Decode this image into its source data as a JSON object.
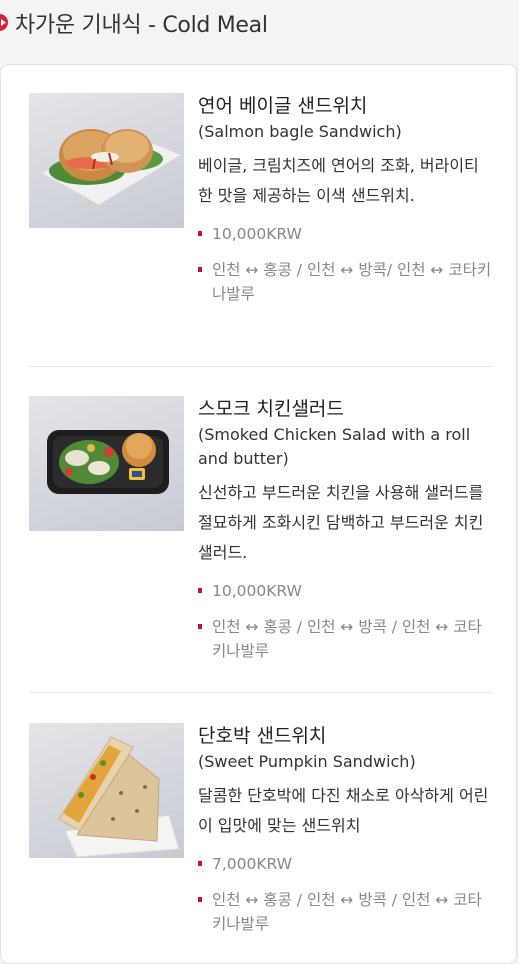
{
  "header": {
    "title": "차가운 기내식 - Cold Meal",
    "icon": "arrow-right-circle-icon",
    "accent_color": "#d8213a"
  },
  "items": [
    {
      "name": "연어 베이글 샌드위치",
      "english": "(Salmon bagle Sandwich)",
      "description": "베이글, 크림치즈에 연어의 조화, 버라이티한 맛을 제공하는 이색 샌드위치.",
      "price": "10,000KRW",
      "routes": "인천 ↔ 홍콩 / 인천 ↔ 방콕/ 인천 ↔ 코타키나발루"
    },
    {
      "name": "스모크 치킨샐러드",
      "english": "(Smoked Chicken Salad with a roll and butter)",
      "description": "신선하고 부드러운 치킨을 사용해 샐러드를 절묘하게 조화시킨 담백하고 부드러운 치킨샐러드.",
      "price": "10,000KRW",
      "routes": "인천 ↔ 홍콩 / 인천 ↔ 방콕 / 인천 ↔ 코타키나발루"
    },
    {
      "name": "단호박 샌드위치",
      "english": "(Sweet Pumpkin Sandwich)",
      "description": "달콤한 단호박에 다진 채소로 아삭하게 어린이 입맛에 맞는 샌드위치",
      "price": "7,000KRW",
      "routes": "인천 ↔ 홍콩 / 인천 ↔ 방콕 / 인천 ↔ 코타키나발루"
    }
  ]
}
